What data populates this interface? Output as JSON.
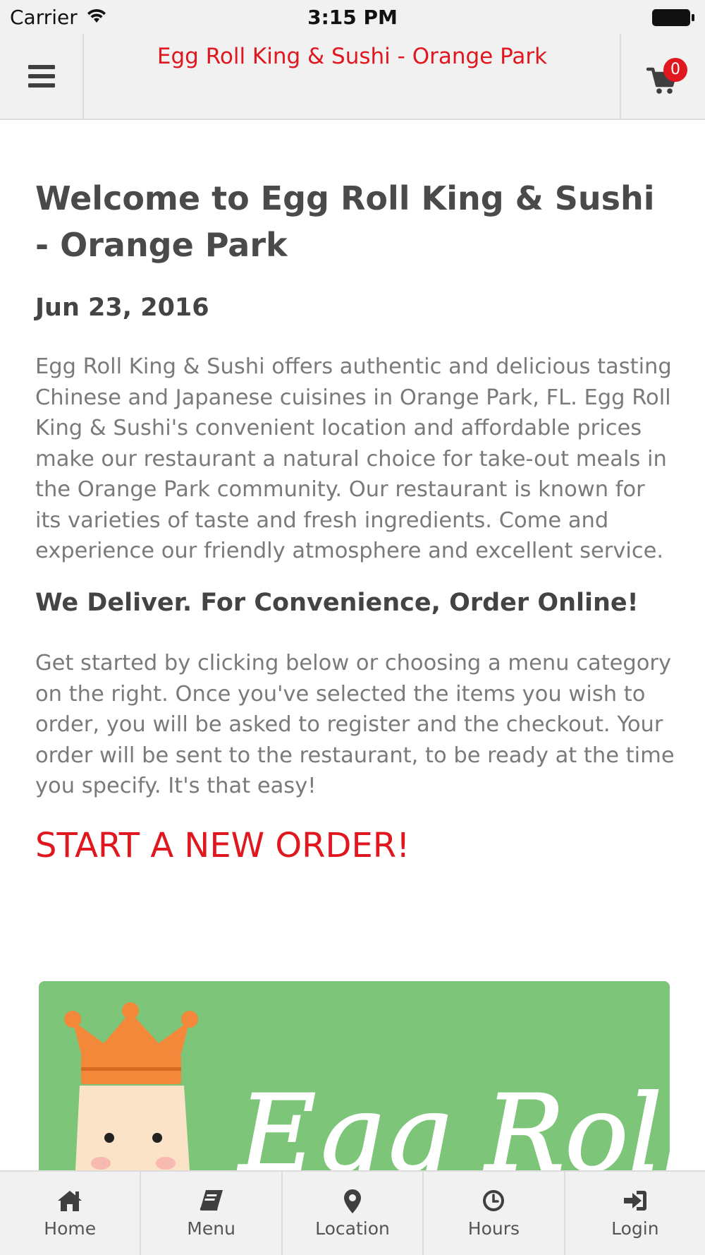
{
  "status_bar": {
    "carrier": "Carrier",
    "time": "3:15 PM"
  },
  "navbar": {
    "title": "Egg Roll King & Sushi - Orange Park",
    "cart_count": "0",
    "menu_icon": "hamburger-icon",
    "cart_icon": "cart-icon"
  },
  "main": {
    "heading": "Welcome to Egg Roll King & Sushi - Orange Park",
    "date": "Jun 23, 2016",
    "intro": "Egg Roll King & Sushi offers authentic and delicious tasting Chinese and Japanese cuisines in Orange Park, FL. Egg Roll King & Sushi's convenient location and affordable prices make our restaurant a natural choice for take-out meals in the Orange Park community. Our restaurant is known for its varieties of taste and fresh ingredients. Come and experience our friendly atmosphere and excellent service.",
    "deliver_heading": "We Deliver. For Convenience, Order Online!",
    "instructions": "Get started by clicking below or choosing a menu category on the right. Once you've selected the items you wish to order, you will be asked to register and the checkout. Your order will be sent to the restaurant, to be ready at the time you specify. It's that easy!",
    "start_order": "START A NEW ORDER!"
  },
  "banner": {
    "logo_text": "Egg Roll",
    "background_color": "#7dc579"
  },
  "tabs": [
    {
      "label": "Home",
      "icon": "home-icon"
    },
    {
      "label": "Menu",
      "icon": "book-icon"
    },
    {
      "label": "Location",
      "icon": "map-pin-icon"
    },
    {
      "label": "Hours",
      "icon": "clock-icon"
    },
    {
      "label": "Login",
      "icon": "sign-in-icon"
    }
  ],
  "colors": {
    "accent": "#e0171f",
    "bar_background": "#f1f1f1"
  }
}
